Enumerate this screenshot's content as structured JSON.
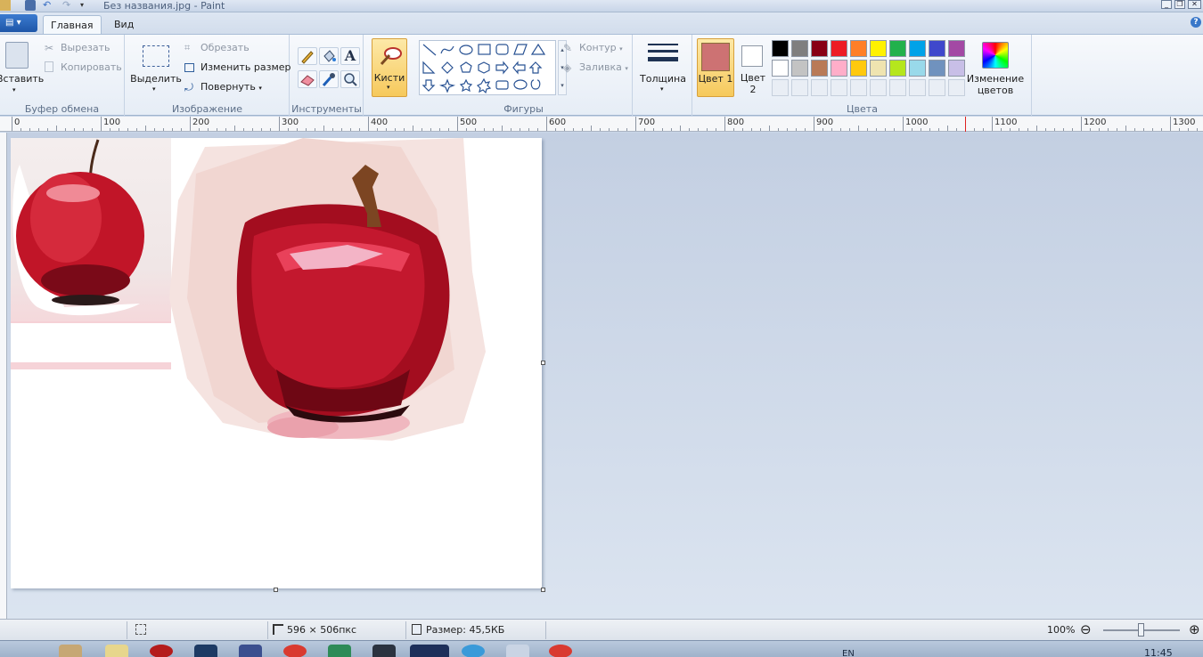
{
  "window": {
    "title": "Без названия.jpg - Paint",
    "minimize": "_",
    "restore": "❐",
    "close": "✕"
  },
  "tabs": {
    "file_menu": "▤ ▾",
    "home": "Главная",
    "view": "Вид",
    "help": "?"
  },
  "ribbon": {
    "clipboard": {
      "label": "Буфер обмена",
      "paste": "Вставить",
      "cut": "Вырезать",
      "copy": "Копировать"
    },
    "image": {
      "label": "Изображение",
      "select": "Выделить",
      "crop": "Обрезать",
      "resize": "Изменить размер",
      "rotate": "Повернуть"
    },
    "tools": {
      "label": "Инструменты"
    },
    "brushes": {
      "label": "Кисти"
    },
    "shapes": {
      "label": "Фигуры",
      "outline": "Контур",
      "fill": "Заливка"
    },
    "thickness": {
      "label": "Толщина"
    },
    "colors": {
      "label": "Цвета",
      "color1": "Цвет 1",
      "color2": "Цвет 2",
      "edit_colors": "Изменение цветов",
      "color1_value": "#cd7273",
      "color2_value": "#ffffff",
      "palette_row1": [
        "#000000",
        "#7f7f7f",
        "#880015",
        "#ed1c24",
        "#ff7f27",
        "#fff200",
        "#22b14c",
        "#00a2e8",
        "#3f48cc",
        "#a349a4"
      ],
      "palette_row2": [
        "#ffffff",
        "#c3c3c3",
        "#b97a57",
        "#ffaec9",
        "#ffc90e",
        "#efe4b0",
        "#b5e61d",
        "#99d9ea",
        "#7092be",
        "#c8bfe7"
      ]
    }
  },
  "ruler": {
    "ticks": [
      "0",
      "100",
      "200",
      "300",
      "400",
      "500",
      "600",
      "700",
      "800",
      "900",
      "1000",
      "1100",
      "1200",
      "1300"
    ]
  },
  "status": {
    "dimensions": "596 × 506пкс",
    "size": "Размер: 45,5КБ",
    "zoom": "100%",
    "zoom_out": "⊖",
    "zoom_in": "⊕"
  },
  "taskbar": {
    "lang": "EN",
    "time": "11:45"
  }
}
